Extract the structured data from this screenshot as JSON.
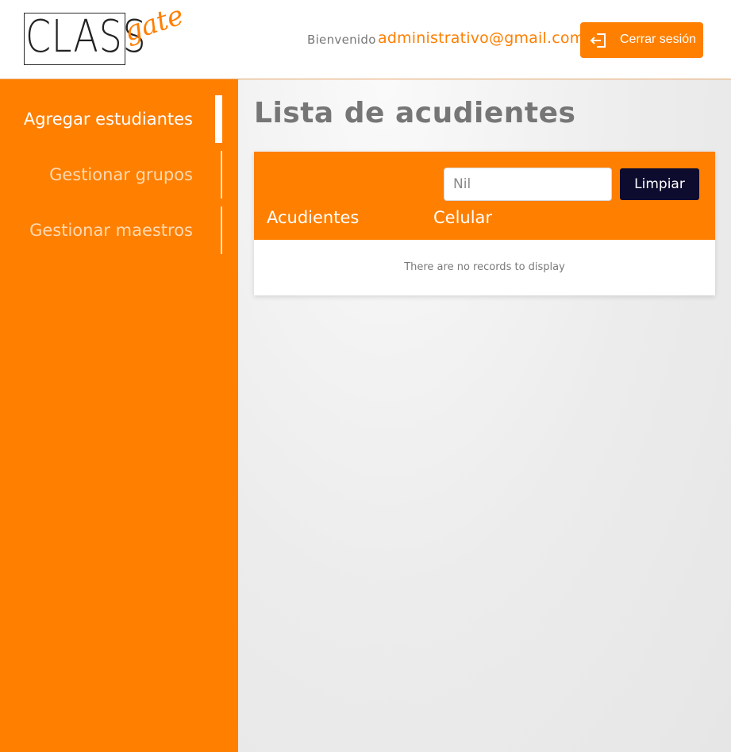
{
  "header": {
    "logo": {
      "primary": "CLASS",
      "secondary": "gate"
    },
    "welcome_label": "Bienvenido",
    "user_email": "administrativo@gmail.com",
    "logout_label": "Cerrar sesión",
    "logout_icon": "sign-out-icon"
  },
  "sidebar": {
    "items": [
      {
        "label": "Agregar estudiantes",
        "active": true
      },
      {
        "label": "Gestionar grupos",
        "active": false
      },
      {
        "label": "Gestionar maestros",
        "active": false
      }
    ]
  },
  "main": {
    "title": "Lista de acudientes",
    "table": {
      "search": {
        "value": "",
        "placeholder": "Nil"
      },
      "clear_label": "Limpiar",
      "columns": [
        "Acudientes",
        "Celular"
      ],
      "rows": [],
      "empty_message": "There are no records to display"
    }
  },
  "colors": {
    "accent": "#ff7f00",
    "button_dark": "#0d0b2e",
    "title_gray": "#767676"
  }
}
